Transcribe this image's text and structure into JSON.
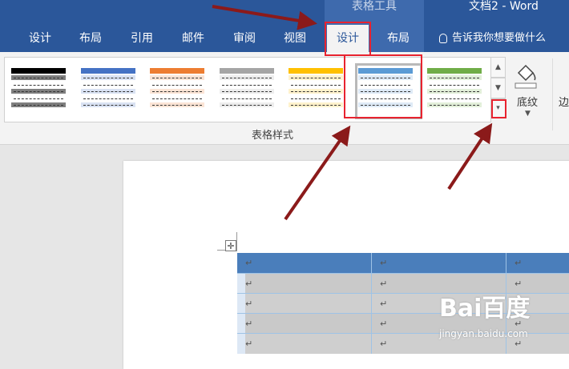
{
  "titlebar": {
    "context_label": "表格工具",
    "doc_title": "文档2  -  Word"
  },
  "tabs": [
    {
      "label": "设计",
      "active": false
    },
    {
      "label": "布局",
      "active": false
    },
    {
      "label": "引用",
      "active": false
    },
    {
      "label": "邮件",
      "active": false
    },
    {
      "label": "审阅",
      "active": false
    },
    {
      "label": "视图",
      "active": false
    },
    {
      "label": "设计",
      "active": true
    },
    {
      "label": "布局",
      "active": false
    }
  ],
  "tellme": {
    "text": "告诉我你想要做什么"
  },
  "ribbon": {
    "group_label": "表格样式",
    "shading_label": "底纹",
    "borders_label": "边",
    "gallery_styles": [
      {
        "name": "black",
        "header": "#000000",
        "band": "#7f7f7f"
      },
      {
        "name": "blue",
        "header": "#4472c4",
        "band": "#d9e2f3"
      },
      {
        "name": "orange",
        "header": "#ed7d31",
        "band": "#fbe4d5"
      },
      {
        "name": "gray",
        "header": "#a5a5a5",
        "band": "#ededed"
      },
      {
        "name": "gold",
        "header": "#ffc000",
        "band": "#fff2cc"
      },
      {
        "name": "lightblue",
        "header": "#5b9bd5",
        "band": "#deeaf6"
      },
      {
        "name": "green",
        "header": "#70ad47",
        "band": "#e2efd9"
      }
    ]
  },
  "document": {
    "cell_mark": "↵",
    "header_color": "#4a7ebb",
    "band_color": "#c9c9c9"
  },
  "watermark": {
    "logo": "Bai百度",
    "sub": "jingyan.baidu.com"
  },
  "colors": {
    "accent": "#2b579a",
    "annotation": "#e8232f",
    "arrow": "#8b1a1a"
  }
}
